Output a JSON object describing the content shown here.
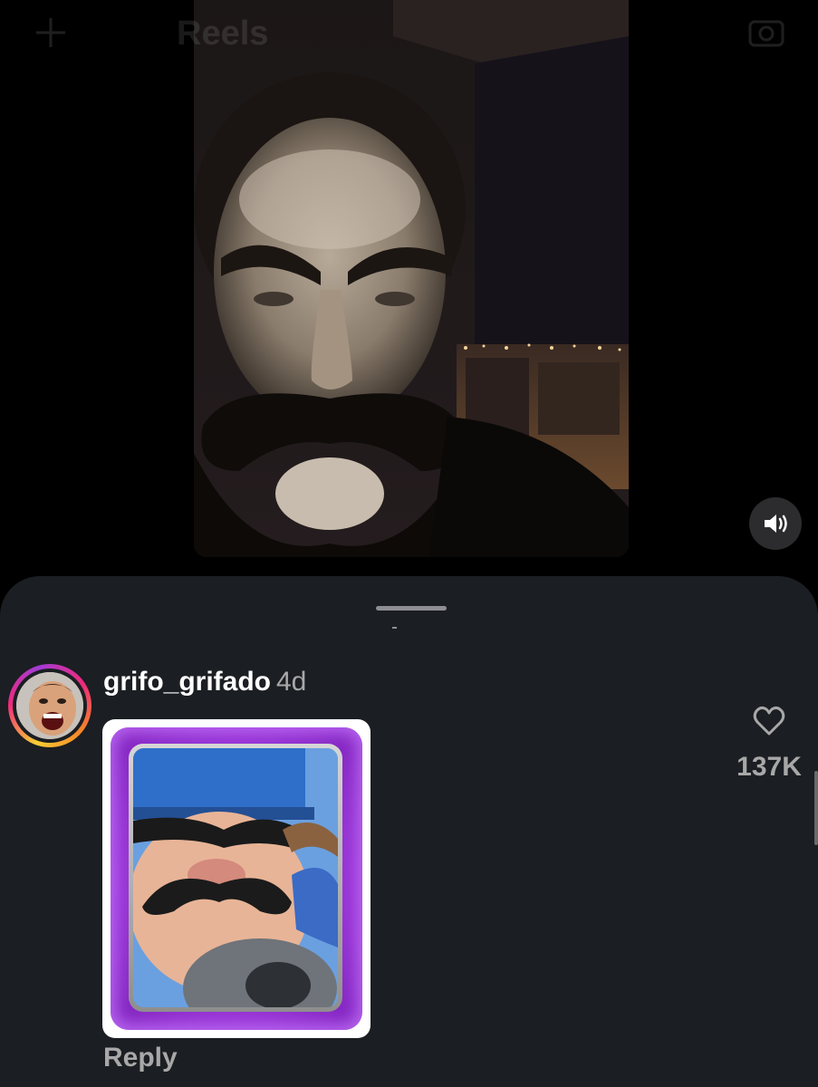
{
  "top_bar": {
    "title": "Reels",
    "left_icon": "plus-icon",
    "right_icon": "camera-icon"
  },
  "video": {
    "sound_icon": "speaker-icon"
  },
  "comment": {
    "username": "grifo_grifado",
    "time": "4d",
    "avatar_icon": "profile-avatar",
    "sticker": "cartoon-character-card-sticker",
    "reply_label": "Reply",
    "like_icon": "heart-outline-icon",
    "like_count": "137K"
  },
  "colors": {
    "sheet_background": "#1b1e22",
    "username": "#ffffff",
    "secondary_text": "#a8a8a8",
    "sticker_glow": "#a83be0"
  }
}
